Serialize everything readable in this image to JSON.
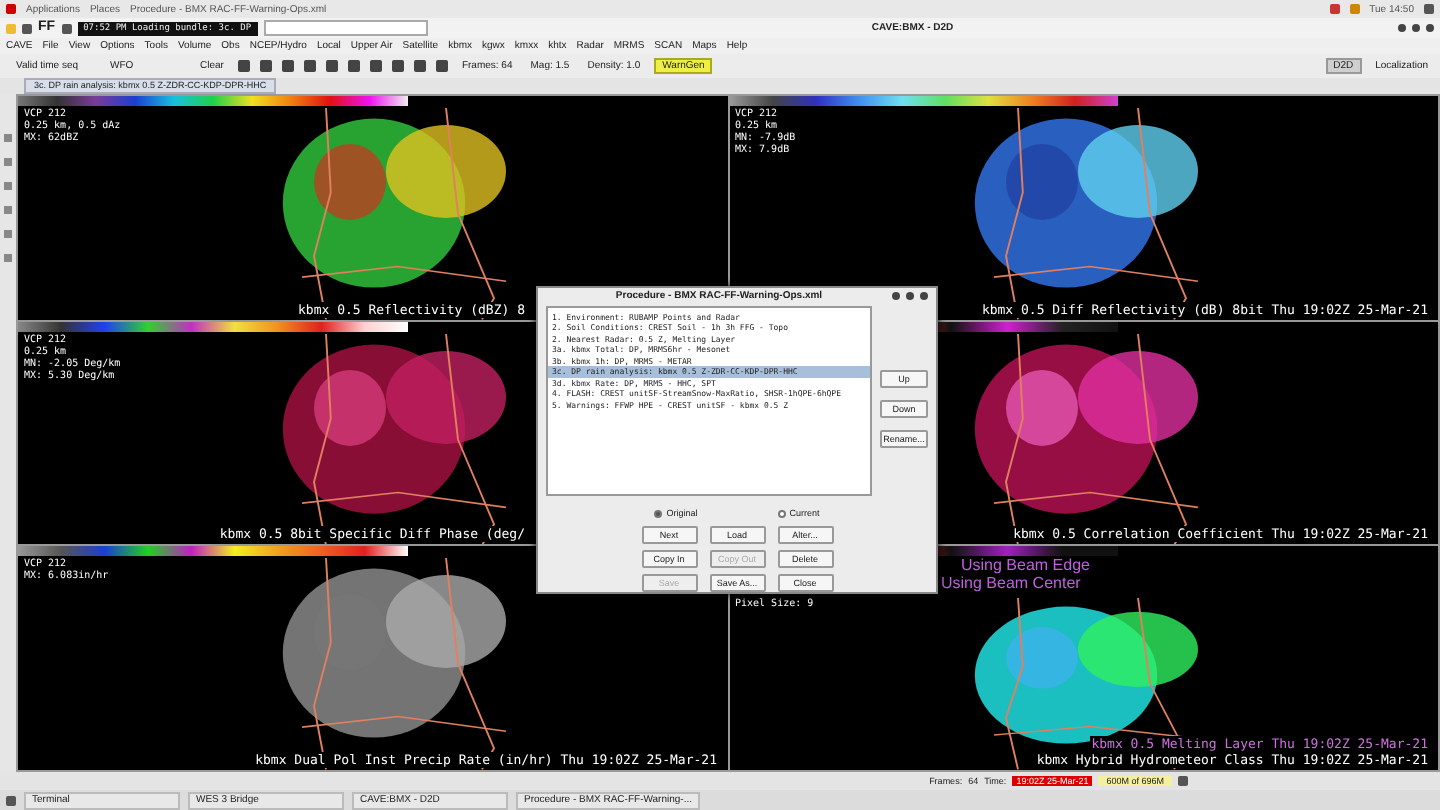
{
  "top_bar": {
    "menus": [
      "Applications",
      "Places"
    ],
    "window_title": "Procedure - BMX RAC-FF-Warning-Ops.xml",
    "clock": "Tue 14:50"
  },
  "title_bar": {
    "ff_label": "FF",
    "loading_text": "07:52 PM Loading bundle: 3c. DP",
    "title": "CAVE:BMX - D2D"
  },
  "menu": [
    "CAVE",
    "File",
    "View",
    "Options",
    "Tools",
    "Volume",
    "Obs",
    "NCEP/Hydro",
    "Local",
    "Upper Air",
    "Satellite",
    "kbmx",
    "kgwx",
    "kmxx",
    "khtx",
    "Radar",
    "MRMS",
    "SCAN",
    "Maps",
    "Help"
  ],
  "toolbar": {
    "time_mode": "Valid time seq",
    "scale": "WFO",
    "clear": "Clear",
    "frames": "Frames: 64",
    "mag": "Mag: 1.5",
    "density": "Density: 1.0",
    "warngen": "WarnGen",
    "perspective": "D2D",
    "localization": "Localization"
  },
  "tab": {
    "label": "3c. DP rain analysis: kbmx 0.5 Z-ZDR-CC-KDP-DPR-HHC"
  },
  "panels": [
    {
      "info": [
        "VCP 212",
        "0.25 km, 0.5 dAz",
        "MX: 62dBZ"
      ],
      "labels": [
        "kbmx 0.5 Reflectivity (dBZ) 8"
      ]
    },
    {
      "info": [
        "VCP 212",
        "0.25 km",
        "MN: -7.9dB",
        "MX: 7.9dB"
      ],
      "labels": [
        "kbmx 0.5 Diff Reflectivity (dB) 8bit  Thu 19:02Z 25-Mar-21"
      ]
    },
    {
      "info": [
        "VCP 212",
        "0.25 km",
        "MN: -2.05 Deg/km",
        "MX: 5.30 Deg/km"
      ],
      "labels": [
        "kbmx 0.5 8bit Specific Diff Phase (deg/"
      ]
    },
    {
      "labels": [
        "kbmx 0.5 Correlation Coefficient  Thu 19:02Z 25-Mar-21"
      ]
    },
    {
      "info": [
        "VCP 212",
        "MX: 6.083in/hr"
      ],
      "labels": [
        "kbmx Dual Pol Inst Precip Rate (in/hr)  Thu 19:02Z 25-Mar-21"
      ]
    },
    {
      "info": [
        "Pixel Size: 9"
      ],
      "labels": [
        "kbmx 0.5 Melting Layer  Thu 19:02Z 25-Mar-21",
        "kbmx Hybrid Hydrometeor Class  Thu 19:02Z 25-Mar-21"
      ],
      "overlays": [
        "Using Beam Edge",
        "Using Beam Center"
      ]
    }
  ],
  "dialog": {
    "title": "Procedure - BMX RAC-FF-Warning-Ops.xml",
    "items": [
      {
        "text": "1. Environment: RUBAMP Points and Radar",
        "selected": false
      },
      {
        "text": "2. Soil Conditions: CREST Soil - 1h 3h FFG - Topo",
        "selected": false
      },
      {
        "text": "2. Nearest Radar: 0.5 Z, Melting Layer",
        "selected": false
      },
      {
        "text": "3a. kbmx Total: DP, MRMS6hr - Mesonet",
        "selected": false
      },
      {
        "text": "3b. kbmx 1h: DP, MRMS - METAR",
        "selected": false
      },
      {
        "text": "3c. DP rain analysis: kbmx 0.5 Z-ZDR-CC-KDP-DPR-HHC",
        "selected": true
      },
      {
        "text": "3d. kbmx Rate: DP, MRMS - HHC, SPT",
        "selected": false
      },
      {
        "text": "4. FLASH: CREST unitSF-StreamSnow-MaxRatio, SHSR-1hQPE-6hQPE",
        "selected": false
      },
      {
        "text": "5. Warnings: FFWP HPE - CREST unitSF - kbmx 0.5 Z",
        "selected": false
      }
    ],
    "side_buttons": [
      "Up",
      "Down",
      "Rename..."
    ],
    "radios": [
      {
        "label": "Original",
        "selected": true
      },
      {
        "label": "Current",
        "selected": false
      }
    ],
    "buttons": [
      {
        "label": "Next",
        "disabled": false
      },
      {
        "label": "Load",
        "disabled": false
      },
      {
        "label": "Alter...",
        "disabled": false
      },
      {
        "label": "Copy In",
        "disabled": false
      },
      {
        "label": "Copy Out",
        "disabled": true
      },
      {
        "label": "Delete",
        "disabled": false
      },
      {
        "label": "Save",
        "disabled": true
      },
      {
        "label": "Save As...",
        "disabled": false
      },
      {
        "label": "Close",
        "disabled": false
      }
    ]
  },
  "status": {
    "frames_label": "Frames:",
    "frames": "64",
    "time_label": "Time:",
    "time": "19:02Z 25-Mar-21",
    "memory": "600M of 696M"
  },
  "taskbar": [
    "Terminal",
    "WES 3 Bridge",
    "CAVE:BMX - D2D",
    "Procedure - BMX RAC-FF-Warning-..."
  ]
}
